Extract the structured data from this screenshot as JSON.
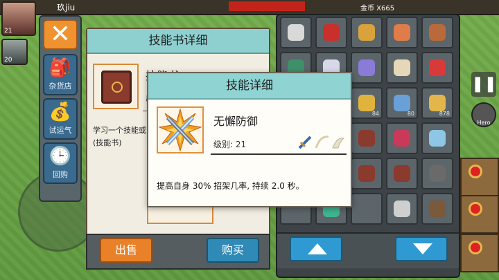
{
  "hud": {
    "player_name": "玖jiu",
    "player_level": "21",
    "ally_level": "20",
    "coin_text": "金币 X665",
    "pause_glyph": "❚❚",
    "hero_label": "Hero"
  },
  "shop_nav": {
    "close_glyph": "✕",
    "items": [
      {
        "label": "杂货店",
        "icon": "backpack-icon"
      },
      {
        "label": "试运气",
        "icon": "lucky-bag-icon"
      },
      {
        "label": "回购",
        "icon": "clock-icon"
      }
    ]
  },
  "book_panel": {
    "title": "技能书详细",
    "book_name": "技能书",
    "book_sub": "出",
    "description": "学习一个技能或(技能书)"
  },
  "shop_buttons": {
    "sell": "出售",
    "buy": "购买"
  },
  "inventory": {
    "slots": [
      {
        "icon": "drill-icon",
        "color": "#d9d9d9",
        "qty": ""
      },
      {
        "icon": "gem-icon",
        "color": "#c9302c",
        "qty": ""
      },
      {
        "icon": "staff-icon",
        "color": "#d9a23a",
        "qty": ""
      },
      {
        "icon": "staff-icon",
        "color": "#e07b4a",
        "qty": ""
      },
      {
        "icon": "sack-icon",
        "color": "#b86a3a",
        "qty": ""
      },
      {
        "icon": "bow-icon",
        "color": "#3f8f6a",
        "qty": ""
      },
      {
        "icon": "wing-icon",
        "color": "#d8d8e8",
        "qty": ""
      },
      {
        "icon": "wisp-icon",
        "color": "#8a7bd6",
        "qty": ""
      },
      {
        "icon": "scroll-icon",
        "color": "#e6d7b8",
        "qty": ""
      },
      {
        "icon": "potion-icon",
        "color": "#d83a3a",
        "qty": ""
      },
      {
        "icon": "blank-icon",
        "color": "#5b656a",
        "qty": ""
      },
      {
        "icon": "blank-icon",
        "color": "#5b656a",
        "qty": ""
      },
      {
        "icon": "key-icon",
        "color": "#e0b33c",
        "qty": "84"
      },
      {
        "icon": "scroll-icon",
        "color": "#6aa0d8",
        "qty": "80"
      },
      {
        "icon": "coins-icon",
        "color": "#e2b64a",
        "qty": "878"
      },
      {
        "icon": "blank-icon",
        "color": "#5b656a",
        "qty": ""
      },
      {
        "icon": "blank-icon",
        "color": "#5b656a",
        "qty": ""
      },
      {
        "icon": "book-icon",
        "color": "#8b3a2e",
        "qty": ""
      },
      {
        "icon": "demon-mask-icon",
        "color": "#c93a5a",
        "qty": ""
      },
      {
        "icon": "ice-sword-icon",
        "color": "#8ec6e6",
        "qty": ""
      },
      {
        "icon": "blank-icon",
        "color": "#5b656a",
        "qty": ""
      },
      {
        "icon": "ring-icon",
        "color": "#5ac2c2",
        "qty": ""
      },
      {
        "icon": "book-icon",
        "color": "#8b3a2e",
        "qty": ""
      },
      {
        "icon": "book-icon",
        "color": "#8b3a2e",
        "qty": ""
      },
      {
        "icon": "armor-icon",
        "color": "#6a6a6a",
        "qty": ""
      },
      {
        "icon": "blank-icon",
        "color": "#5b656a",
        "qty": ""
      },
      {
        "icon": "robe-icon",
        "color": "#3fb58f",
        "qty": ""
      },
      {
        "icon": "blank-icon",
        "color": "#5b656a",
        "qty": ""
      },
      {
        "icon": "sword-icon",
        "color": "#cfcfcf",
        "qty": ""
      },
      {
        "icon": "pickaxe-icon",
        "color": "#7a5a3a",
        "qty": ""
      }
    ]
  },
  "popup": {
    "title": "技能详细",
    "skill_name": "无懈防御",
    "level_text": "级别: 21",
    "description": "提高自身 30% 招架几率, 持续 2.0 秒。"
  },
  "colors": {
    "header_teal": "#8fd3d3",
    "sell_orange": "#e98128",
    "buy_blue": "#2f8ab7",
    "panel_bg": "#fffdf8"
  }
}
